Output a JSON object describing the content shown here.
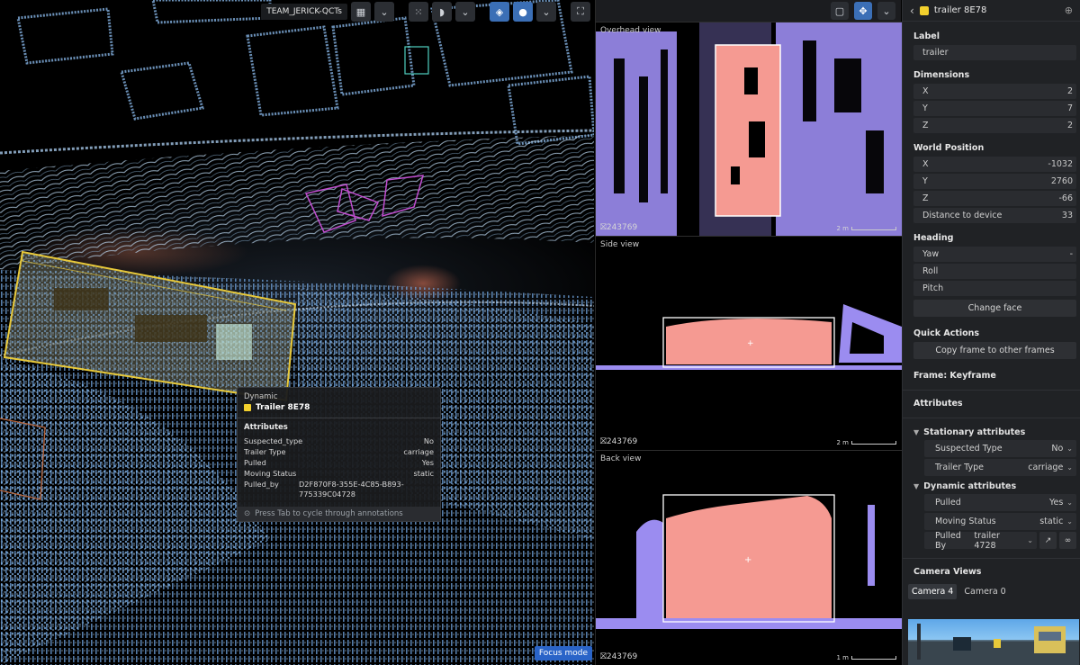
{
  "viewport": {
    "team_label": "TEAM_JERICK-QCTs",
    "focus_mode": "Focus mode"
  },
  "tooltip": {
    "kind": "Dynamic",
    "title": "Trailer 8E78",
    "section": "Attributes",
    "rows": [
      {
        "k": "Suspected_type",
        "v": "No"
      },
      {
        "k": "Trailer Type",
        "v": "carriage"
      },
      {
        "k": "Pulled",
        "v": "Yes"
      },
      {
        "k": "Moving Status",
        "v": "static"
      },
      {
        "k": "Pulled_by",
        "v": "D2F870F8-355E-4C85-B893-775339C04728"
      }
    ],
    "hint": "Press Tab to cycle through annotations"
  },
  "views": {
    "overhead": {
      "title": "Overhead view",
      "id": "243769",
      "scale": "2 m"
    },
    "side": {
      "title": "Side view",
      "id": "243769",
      "scale": "2 m"
    },
    "back": {
      "title": "Back view",
      "id": "243769",
      "scale": "1 m"
    }
  },
  "panel": {
    "header_title": "trailer 8E78",
    "label_section": "Label",
    "label_value": "trailer",
    "dimensions_section": "Dimensions",
    "dimensions": [
      {
        "k": "X",
        "v": "2"
      },
      {
        "k": "Y",
        "v": "7"
      },
      {
        "k": "Z",
        "v": "2"
      }
    ],
    "world_position_section": "World Position",
    "world_position": [
      {
        "k": "X",
        "v": "-1032"
      },
      {
        "k": "Y",
        "v": "2760"
      },
      {
        "k": "Z",
        "v": "-66"
      },
      {
        "k": "Distance to device",
        "v": "33"
      }
    ],
    "heading_section": "Heading",
    "heading": [
      {
        "k": "Yaw",
        "v": "-"
      },
      {
        "k": "Roll",
        "v": ""
      },
      {
        "k": "Pitch",
        "v": ""
      }
    ],
    "change_face": "Change face",
    "quick_actions_section": "Quick Actions",
    "copy_frame": "Copy frame to other frames",
    "frame_label": "Frame: Keyframe",
    "attributes_section": "Attributes",
    "stationary_group": "Stationary attributes",
    "stationary": [
      {
        "k": "Suspected Type",
        "v": "No"
      },
      {
        "k": "Trailer Type",
        "v": "carriage"
      }
    ],
    "dynamic_group": "Dynamic attributes",
    "dynamic": [
      {
        "k": "Pulled",
        "v": "Yes"
      },
      {
        "k": "Moving Status",
        "v": "static"
      }
    ],
    "pulled_by_key": "Pulled By",
    "pulled_by_value": "trailer 4728",
    "camera_views_section": "Camera Views",
    "camera_tabs": [
      "Camera 4",
      "Camera 0"
    ]
  },
  "colors": {
    "accent": "#2a64c8",
    "annotation_yellow": "#f2d02d",
    "selection_fill": "#f59a92",
    "cloud_purple": "#9b8cf0"
  }
}
